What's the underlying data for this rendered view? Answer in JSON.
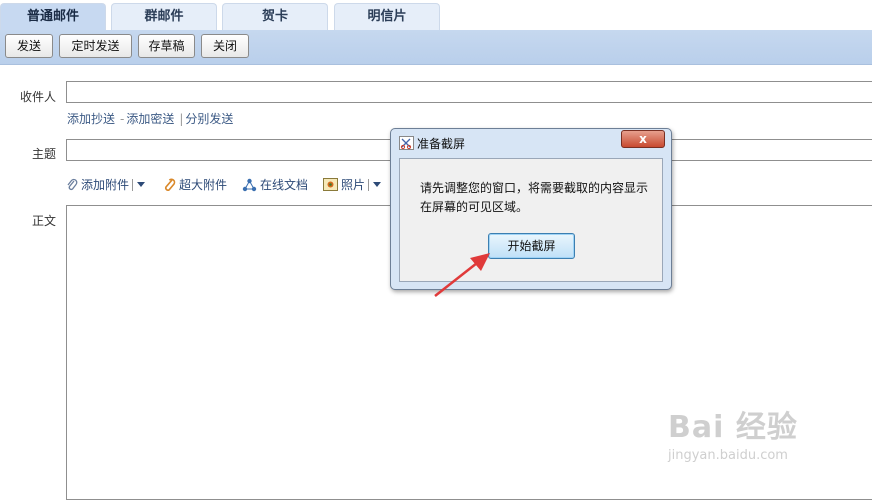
{
  "tabs": [
    "普通邮件",
    "群邮件",
    "贺卡",
    "明信片"
  ],
  "toolbar": {
    "send": "发送",
    "scheduled_send": "定时发送",
    "save_draft": "存草稿",
    "close": "关闭"
  },
  "form": {
    "recipient_label": "收件人",
    "add_cc": "添加抄送",
    "add_bcc": "添加密送",
    "separate_send": "分别发送",
    "subject_label": "主题",
    "body_label": "正文"
  },
  "attach_toolbar": {
    "add_attachment": "添加附件",
    "large_attachment": "超大附件",
    "online_doc": "在线文档",
    "photo": "照片"
  },
  "dialog": {
    "title": "准备截屏",
    "close_label": "x",
    "message": "请先调整您的窗口，将需要截取的内容显示在屏幕的可见区域。",
    "start_button": "开始截屏"
  },
  "watermark": {
    "main": "Bai 经验",
    "sub": "jingyan.baidu.com"
  },
  "colors": {
    "arrow": "#e03a3a",
    "link": "#3c5a85",
    "toolbar": "#c6d8ef"
  }
}
